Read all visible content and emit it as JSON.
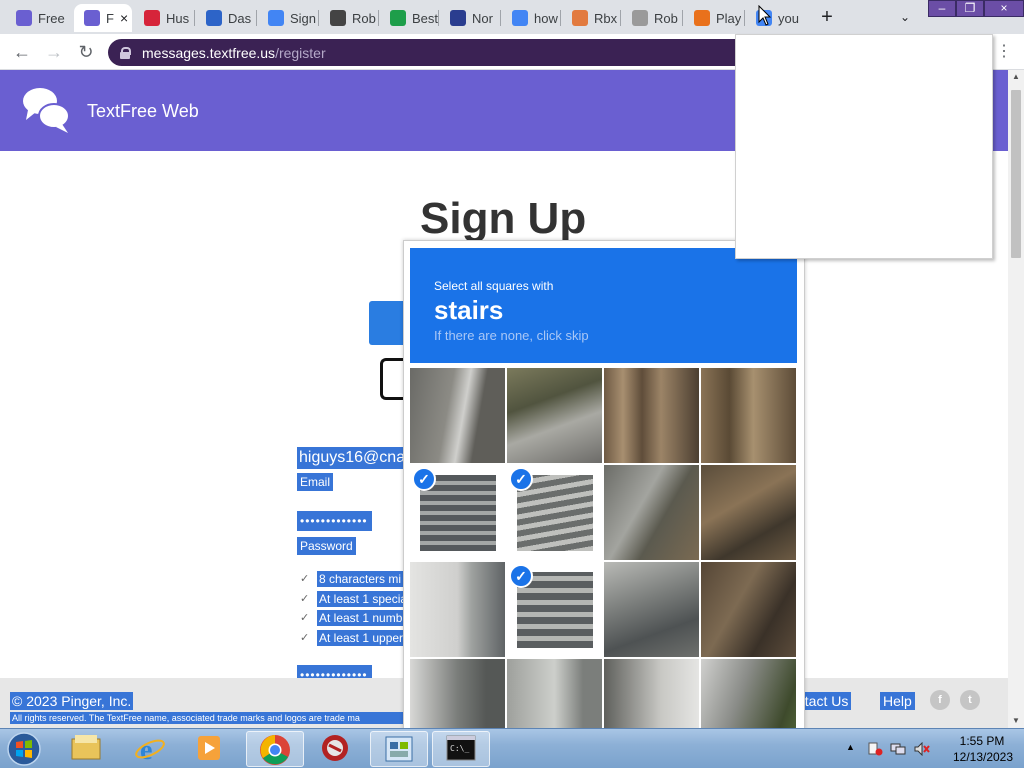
{
  "browser": {
    "tabs": [
      {
        "title": "Free",
        "icon": "chat-bubbles-icon",
        "color": "#6a5fd1"
      },
      {
        "title": "F",
        "icon": "chat-bubbles-icon",
        "color": "#6a5fd1",
        "active": true
      },
      {
        "title": "Hus",
        "icon": "pinger-icon",
        "color": "#d6243a"
      },
      {
        "title": "Das",
        "icon": "sms-icon",
        "color": "#2d64c8"
      },
      {
        "title": "Sign",
        "icon": "google-icon",
        "color": "#4285f4"
      },
      {
        "title": "Rob",
        "icon": "roblox-icon",
        "color": "#444444"
      },
      {
        "title": "Best",
        "icon": "green-circle-icon",
        "color": "#1e9e4a"
      },
      {
        "title": "Nor",
        "icon": "flag-icon",
        "color": "#2a3d8f"
      },
      {
        "title": "how",
        "icon": "google-icon",
        "color": "#4285f4"
      },
      {
        "title": "Rbx",
        "icon": "rainbow-icon",
        "color": "#e27a3f"
      },
      {
        "title": "Rob",
        "icon": "image-icon",
        "color": "#9a9a9a"
      },
      {
        "title": "Play",
        "icon": "game-icon",
        "color": "#e9711c"
      },
      {
        "title": "you",
        "icon": "google-icon",
        "color": "#4285f4"
      }
    ],
    "url_host": "messages.textfree.us",
    "url_path": "/register",
    "window_controls": [
      "minimize",
      "restore",
      "close"
    ]
  },
  "site": {
    "brand": "TextFree Web",
    "brand_color": "#6a5fd1",
    "heading": "Sign Up",
    "email_value": "higuys16@cna",
    "email_label": "Email",
    "password_value": "•••••••••••••",
    "password_label": "Password",
    "rules": [
      "8 characters mi",
      "At least 1 specia",
      "At least 1 numb",
      "At least 1 upper"
    ],
    "confirm_value": "•••••••••••••",
    "footer": {
      "copyright": "© 2023 Pinger, Inc.",
      "legal": "All rights reserved. The TextFree name, associated trade marks and logos are trade ma",
      "contact": "ntact Us",
      "help": "Help",
      "social": [
        "facebook-icon",
        "twitter-icon"
      ]
    }
  },
  "captcha": {
    "instruction": "Select all squares with",
    "target": "stairs",
    "hint": "If there are none, click skip",
    "header_color": "#1a73e8",
    "selected": [
      4,
      5,
      9
    ]
  },
  "taskbar": {
    "time": "1:55 PM",
    "date": "12/13/2023",
    "apps": [
      "windows-explorer-icon",
      "internet-explorer-icon",
      "media-player-icon",
      "chrome-icon",
      "game-icon",
      "control-panel-icon",
      "command-prompt-icon"
    ]
  }
}
